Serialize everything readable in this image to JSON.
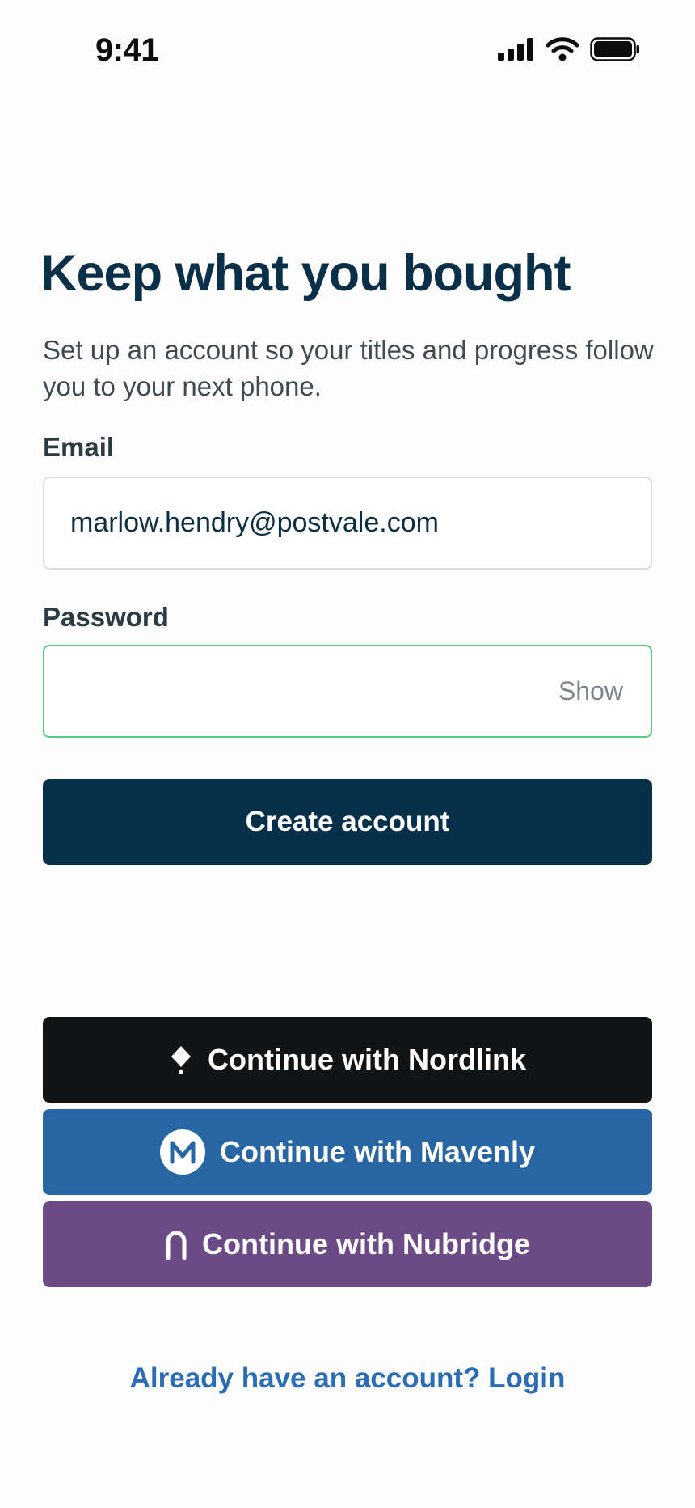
{
  "status_bar": {
    "time": "9:41",
    "icons": [
      "cellular-signal-icon",
      "wifi-icon",
      "battery-icon"
    ]
  },
  "header": {
    "title": "Keep what you bought",
    "subtitle": "Set up an account so your titles and progress follow you to your next phone."
  },
  "form": {
    "email_label": "Email",
    "email_value": "marlow.hendry@postvale.com",
    "password_label": "Password",
    "password_value": "",
    "show_label": "Show",
    "submit_label": "Create account"
  },
  "social": {
    "nordlink_label": "Continue with Nordlink",
    "mavenly_label": "Continue with Mavenly",
    "nubridge_label": "Continue with Nubridge"
  },
  "footer": {
    "login_link": "Already have an account? Login"
  },
  "colors": {
    "primary": "#06304a",
    "nordlink": "#121314",
    "mavenly": "#2766a3",
    "nubridge": "#6c4a86",
    "focus_border": "#4fcf7e",
    "link": "#2a6db6"
  }
}
